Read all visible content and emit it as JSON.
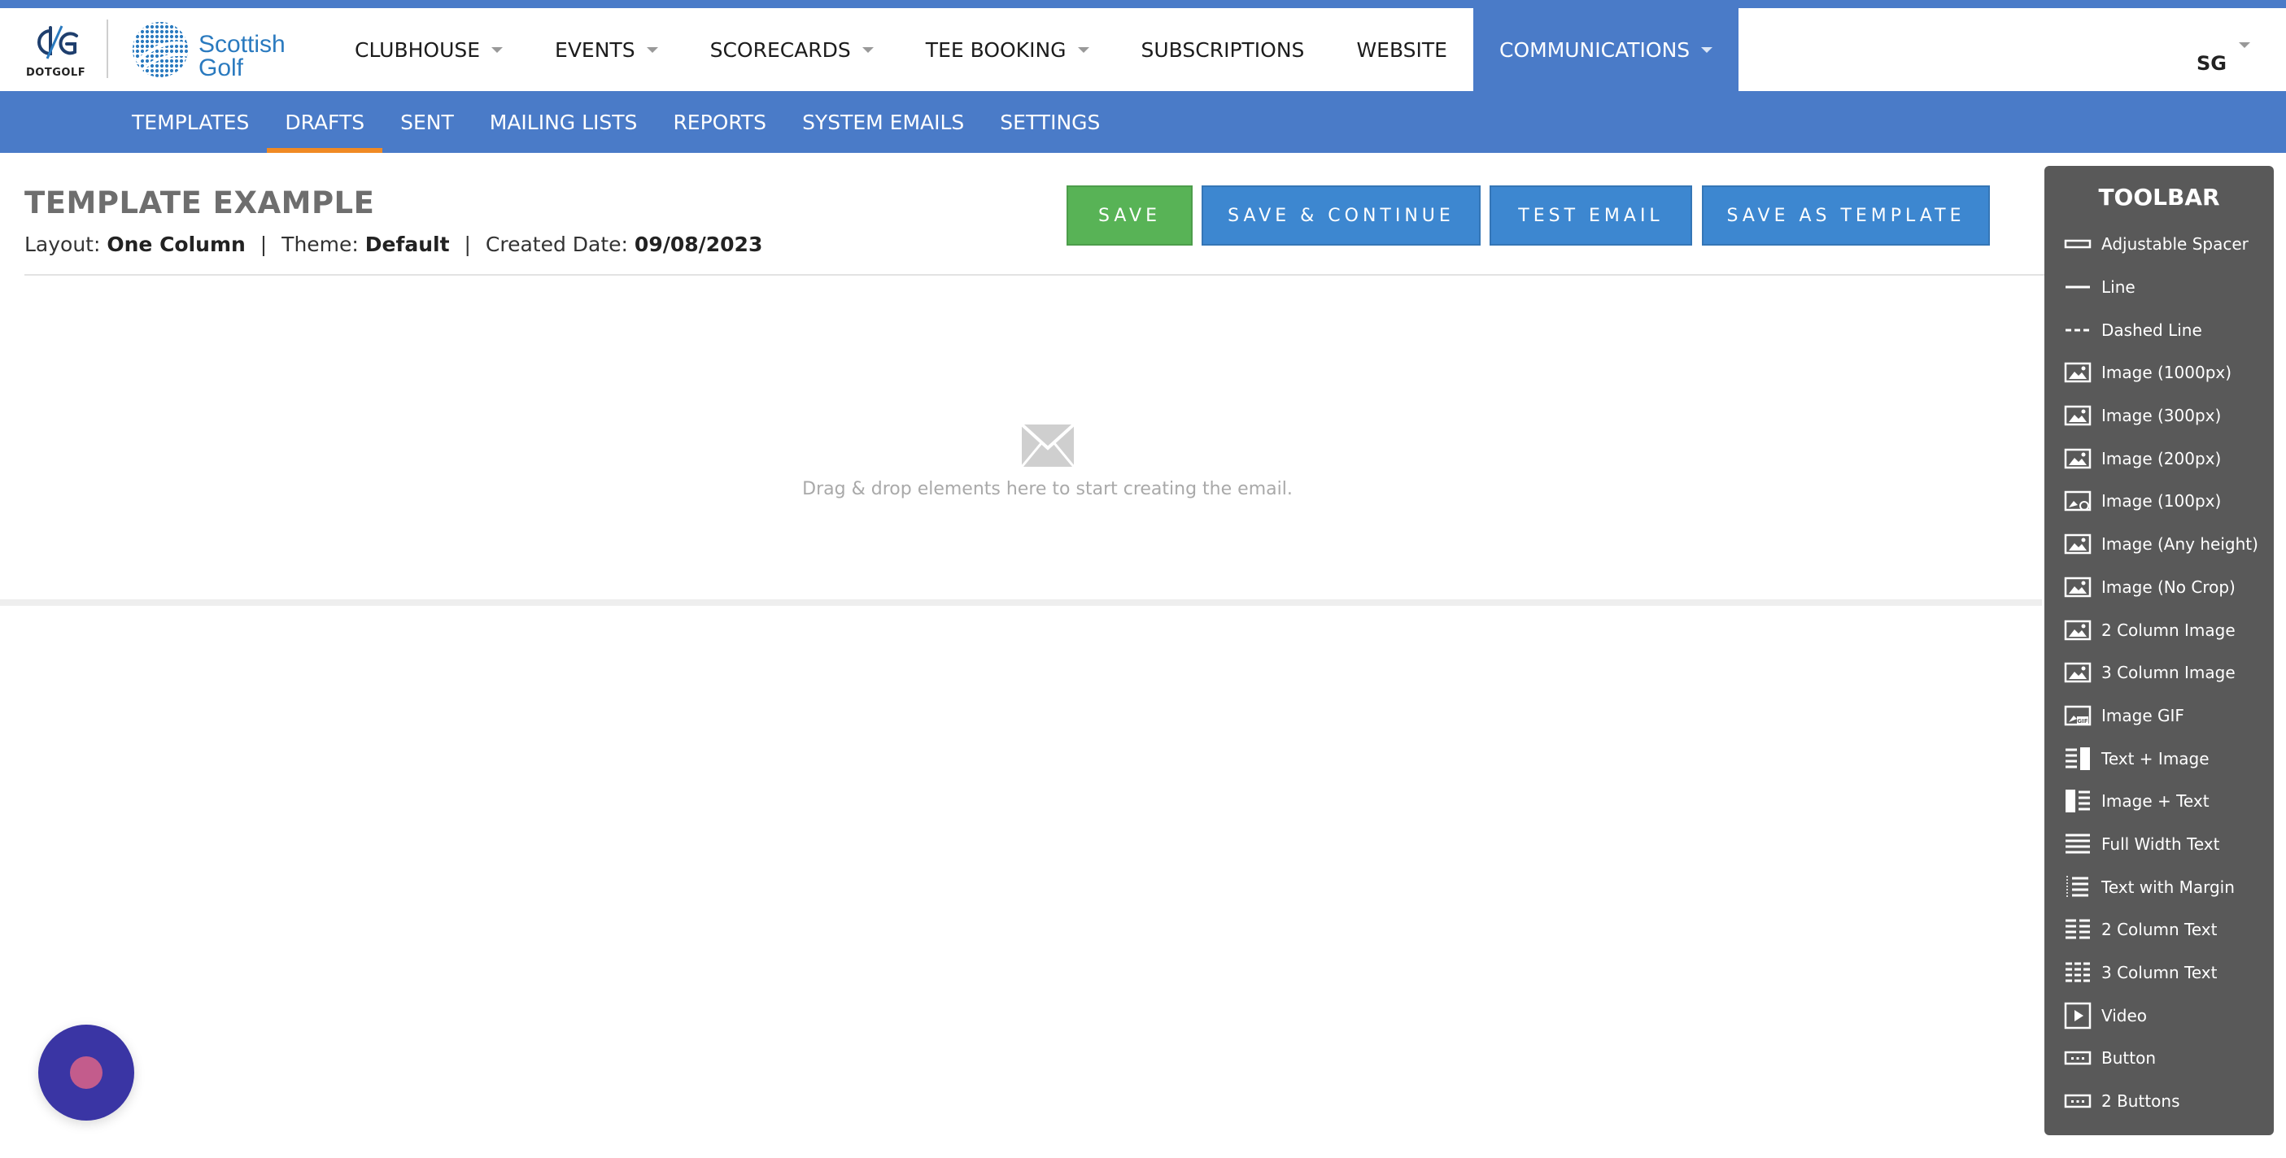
{
  "brand": {
    "dotgolf_label": "DOTGOLF",
    "scottish_golf_line1": "Scottish",
    "scottish_golf_line2": "Golf"
  },
  "nav": {
    "items": [
      {
        "label": "CLUBHOUSE",
        "dropdown": true
      },
      {
        "label": "EVENTS",
        "dropdown": true
      },
      {
        "label": "SCORECARDS",
        "dropdown": true
      },
      {
        "label": "TEE BOOKING",
        "dropdown": true
      },
      {
        "label": "SUBSCRIPTIONS",
        "dropdown": false
      },
      {
        "label": "WEBSITE",
        "dropdown": false
      },
      {
        "label": "COMMUNICATIONS",
        "dropdown": true,
        "active": true
      }
    ],
    "user_initials": "SG"
  },
  "subnav": {
    "items": [
      {
        "label": "TEMPLATES"
      },
      {
        "label": "DRAFTS",
        "active": true
      },
      {
        "label": "SENT"
      },
      {
        "label": "MAILING LISTS"
      },
      {
        "label": "REPORTS"
      },
      {
        "label": "SYSTEM EMAILS"
      },
      {
        "label": "SETTINGS"
      }
    ]
  },
  "page": {
    "title": "TEMPLATE EXAMPLE",
    "layout_label": "Layout:",
    "layout_value": "One Column",
    "theme_label": "Theme:",
    "theme_value": "Default",
    "created_label": "Created Date:",
    "created_value": "09/08/2023",
    "separator": "|"
  },
  "actions": {
    "save": "SAVE",
    "save_continue": "SAVE & CONTINUE",
    "test_email": "TEST EMAIL",
    "save_as_template": "SAVE AS TEMPLATE"
  },
  "canvas": {
    "empty_message": "Drag & drop elements here to start creating the email."
  },
  "toolbar": {
    "title": "TOOLBAR",
    "items": [
      {
        "label": "Adjustable Spacer",
        "icon": "spacer-icon"
      },
      {
        "label": "Line",
        "icon": "line-icon"
      },
      {
        "label": "Dashed Line",
        "icon": "dashed-line-icon"
      },
      {
        "label": "Image (1000px)",
        "icon": "image-icon"
      },
      {
        "label": "Image (300px)",
        "icon": "image-icon"
      },
      {
        "label": "Image (200px)",
        "icon": "image-icon"
      },
      {
        "label": "Image (100px)",
        "icon": "image-small-icon"
      },
      {
        "label": "Image (Any height)",
        "icon": "image-icon"
      },
      {
        "label": "Image (No Crop)",
        "icon": "image-icon"
      },
      {
        "label": "2 Column Image",
        "icon": "image-icon"
      },
      {
        "label": "3 Column Image",
        "icon": "image-icon"
      },
      {
        "label": "Image GIF",
        "icon": "gif-icon"
      },
      {
        "label": "Text + Image",
        "icon": "text-image-icon"
      },
      {
        "label": "Image + Text",
        "icon": "image-text-icon"
      },
      {
        "label": "Full Width Text",
        "icon": "full-text-icon"
      },
      {
        "label": "Text with Margin",
        "icon": "margin-text-icon"
      },
      {
        "label": "2 Column Text",
        "icon": "two-col-text-icon"
      },
      {
        "label": "3 Column Text",
        "icon": "three-col-text-icon"
      },
      {
        "label": "Video",
        "icon": "video-icon"
      },
      {
        "label": "Button",
        "icon": "button-icon"
      },
      {
        "label": "2 Buttons",
        "icon": "buttons-icon"
      }
    ]
  },
  "colors": {
    "primary": "#4a7bc8",
    "save": "#58b356",
    "action": "#3d87d0",
    "active_tab": "#f08a24",
    "toolbar": "#595959",
    "chat": "#3a35a4"
  }
}
